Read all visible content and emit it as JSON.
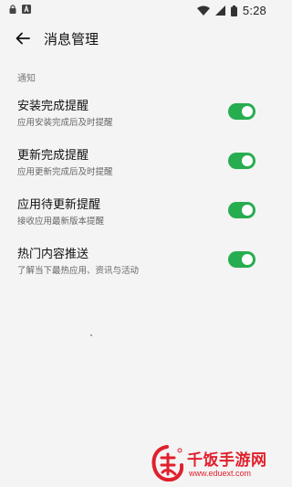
{
  "status_bar": {
    "time": "5:28"
  },
  "header": {
    "title": "消息管理"
  },
  "section": {
    "title": "通知"
  },
  "settings": [
    {
      "title": "安装完成提醒",
      "subtitle": "应用安装完成后及时提醒",
      "enabled": true
    },
    {
      "title": "更新完成提醒",
      "subtitle": "应用更新完成后及时提醒",
      "enabled": true
    },
    {
      "title": "应用待更新提醒",
      "subtitle": "接收应用最新版本提醒",
      "enabled": true
    },
    {
      "title": "热门内容推送",
      "subtitle": "了解当下最热应用、资讯与活动",
      "enabled": true
    }
  ],
  "watermark": {
    "text": "千饭手游网",
    "url": "www.eduext.com"
  },
  "colors": {
    "toggle_on": "#27ad4f",
    "background": "#f4f4f4",
    "watermark": "#e0202c"
  }
}
